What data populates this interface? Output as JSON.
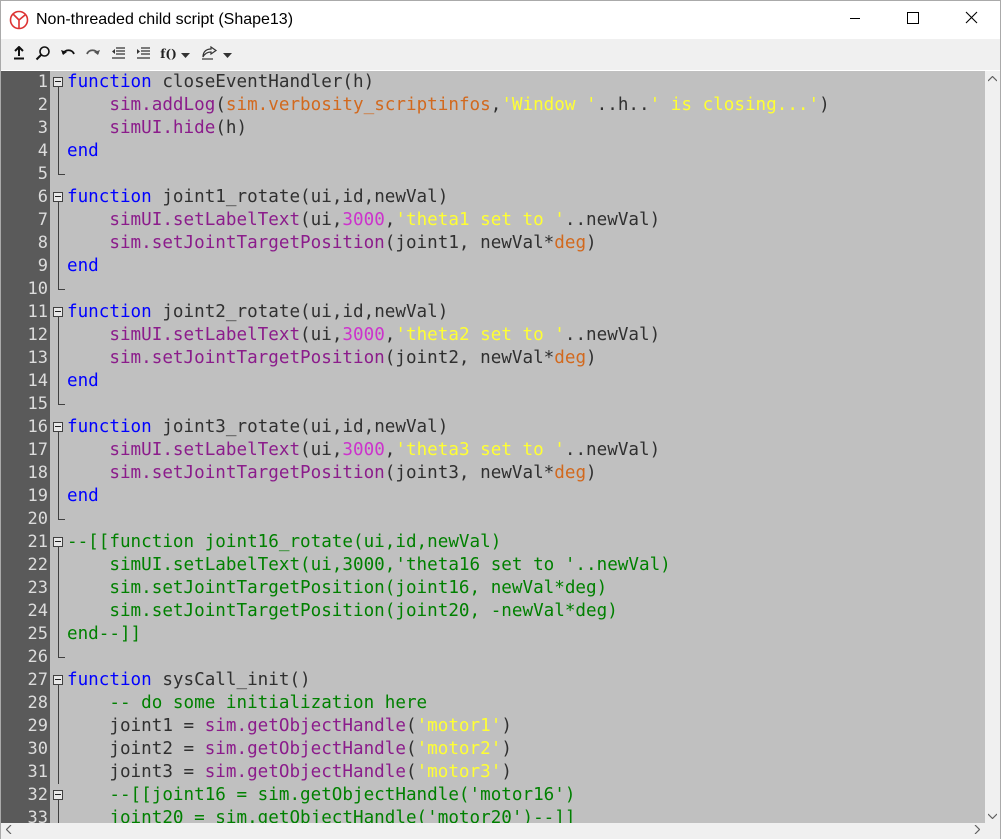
{
  "window": {
    "title": "Non-threaded child script (Shape13)",
    "buttons": {
      "minimize": "minimize-icon",
      "maximize": "maximize-icon",
      "close": "close-icon"
    }
  },
  "toolbar": {
    "items": [
      {
        "name": "export-icon"
      },
      {
        "name": "search-icon"
      },
      {
        "name": "undo-icon"
      },
      {
        "name": "redo-icon"
      },
      {
        "name": "outdent-icon"
      },
      {
        "name": "indent-icon"
      },
      {
        "name": "function-list-icon",
        "label": "f()"
      },
      {
        "name": "script-settings-icon"
      }
    ]
  },
  "colors": {
    "background": "#c0c0c0",
    "gutter": "#5a5a5a",
    "keyword": "#0000ff",
    "sim_api": "#8b1c8b",
    "string": "#ffff33",
    "number": "#cc33cc",
    "comment": "#008000"
  },
  "editor": {
    "lines": [
      {
        "n": "1",
        "fold": "start",
        "tokens": [
          [
            "kw",
            "function"
          ],
          [
            "txt",
            " closeEventHandler(h)"
          ]
        ]
      },
      {
        "n": "2",
        "fold": "mid",
        "tokens": [
          [
            "txt",
            "    "
          ],
          [
            "sim",
            "sim.addLog"
          ],
          [
            "txt",
            "("
          ],
          [
            "deg",
            "sim.verbosity_scriptinfos"
          ],
          [
            "txt",
            ","
          ],
          [
            "str",
            "'Window '"
          ],
          [
            "txt",
            "..h.."
          ],
          [
            "str",
            "' is closing...'"
          ],
          [
            "txt",
            ")"
          ]
        ]
      },
      {
        "n": "3",
        "fold": "mid",
        "tokens": [
          [
            "txt",
            "    "
          ],
          [
            "sim",
            "simUI.hide"
          ],
          [
            "txt",
            "(h)"
          ]
        ]
      },
      {
        "n": "4",
        "fold": "mid",
        "tokens": [
          [
            "kw",
            "end"
          ]
        ]
      },
      {
        "n": "5",
        "fold": "end",
        "tokens": []
      },
      {
        "n": "6",
        "fold": "start",
        "tokens": [
          [
            "kw",
            "function"
          ],
          [
            "txt",
            " joint1_rotate(ui,id,newVal)"
          ]
        ]
      },
      {
        "n": "7",
        "fold": "mid",
        "tokens": [
          [
            "txt",
            "    "
          ],
          [
            "sim",
            "simUI.setLabelText"
          ],
          [
            "txt",
            "(ui,"
          ],
          [
            "num",
            "3000"
          ],
          [
            "txt",
            ","
          ],
          [
            "str",
            "'theta1 set to '"
          ],
          [
            "txt",
            "..newVal)"
          ]
        ]
      },
      {
        "n": "8",
        "fold": "mid",
        "tokens": [
          [
            "txt",
            "    "
          ],
          [
            "sim",
            "sim.setJointTargetPosition"
          ],
          [
            "txt",
            "(joint1, newVal*"
          ],
          [
            "deg",
            "deg"
          ],
          [
            "txt",
            ")"
          ]
        ]
      },
      {
        "n": "9",
        "fold": "mid",
        "tokens": [
          [
            "kw",
            "end"
          ]
        ]
      },
      {
        "n": "10",
        "fold": "end",
        "tokens": []
      },
      {
        "n": "11",
        "fold": "start",
        "tokens": [
          [
            "kw",
            "function"
          ],
          [
            "txt",
            " joint2_rotate(ui,id,newVal)"
          ]
        ]
      },
      {
        "n": "12",
        "fold": "mid",
        "tokens": [
          [
            "txt",
            "    "
          ],
          [
            "sim",
            "simUI.setLabelText"
          ],
          [
            "txt",
            "(ui,"
          ],
          [
            "num",
            "3000"
          ],
          [
            "txt",
            ","
          ],
          [
            "str",
            "'theta2 set to '"
          ],
          [
            "txt",
            "..newVal)"
          ]
        ]
      },
      {
        "n": "13",
        "fold": "mid",
        "tokens": [
          [
            "txt",
            "    "
          ],
          [
            "sim",
            "sim.setJointTargetPosition"
          ],
          [
            "txt",
            "(joint2, newVal*"
          ],
          [
            "deg",
            "deg"
          ],
          [
            "txt",
            ")"
          ]
        ]
      },
      {
        "n": "14",
        "fold": "mid",
        "tokens": [
          [
            "kw",
            "end"
          ]
        ]
      },
      {
        "n": "15",
        "fold": "end",
        "tokens": []
      },
      {
        "n": "16",
        "fold": "start",
        "tokens": [
          [
            "kw",
            "function"
          ],
          [
            "txt",
            " joint3_rotate(ui,id,newVal)"
          ]
        ]
      },
      {
        "n": "17",
        "fold": "mid",
        "tokens": [
          [
            "txt",
            "    "
          ],
          [
            "sim",
            "simUI.setLabelText"
          ],
          [
            "txt",
            "(ui,"
          ],
          [
            "num",
            "3000"
          ],
          [
            "txt",
            ","
          ],
          [
            "str",
            "'theta3 set to '"
          ],
          [
            "txt",
            "..newVal)"
          ]
        ]
      },
      {
        "n": "18",
        "fold": "mid",
        "tokens": [
          [
            "txt",
            "    "
          ],
          [
            "sim",
            "sim.setJointTargetPosition"
          ],
          [
            "txt",
            "(joint3, newVal*"
          ],
          [
            "deg",
            "deg"
          ],
          [
            "txt",
            ")"
          ]
        ]
      },
      {
        "n": "19",
        "fold": "mid",
        "tokens": [
          [
            "kw",
            "end"
          ]
        ]
      },
      {
        "n": "20",
        "fold": "end",
        "tokens": []
      },
      {
        "n": "21",
        "fold": "start",
        "tokens": [
          [
            "cmt",
            "--[[function joint16_rotate(ui,id,newVal)"
          ]
        ]
      },
      {
        "n": "22",
        "fold": "mid",
        "tokens": [
          [
            "cmt",
            "    simUI.setLabelText(ui,3000,'theta16 set to '..newVal)"
          ]
        ]
      },
      {
        "n": "23",
        "fold": "mid",
        "tokens": [
          [
            "cmt",
            "    sim.setJointTargetPosition(joint16, newVal*deg)"
          ]
        ]
      },
      {
        "n": "24",
        "fold": "mid",
        "tokens": [
          [
            "cmt",
            "    sim.setJointTargetPosition(joint20, -newVal*deg)"
          ]
        ]
      },
      {
        "n": "25",
        "fold": "mid",
        "tokens": [
          [
            "cmt",
            "end--]]"
          ]
        ]
      },
      {
        "n": "26",
        "fold": "end",
        "tokens": []
      },
      {
        "n": "27",
        "fold": "start",
        "tokens": [
          [
            "kw",
            "function"
          ],
          [
            "txt",
            " sysCall_init()"
          ]
        ]
      },
      {
        "n": "28",
        "fold": "mid",
        "tokens": [
          [
            "cmt",
            "    -- do some initialization here"
          ]
        ]
      },
      {
        "n": "29",
        "fold": "mid",
        "tokens": [
          [
            "txt",
            "    joint1 = "
          ],
          [
            "sim",
            "sim.getObjectHandle"
          ],
          [
            "txt",
            "("
          ],
          [
            "str",
            "'motor1'"
          ],
          [
            "txt",
            ")"
          ]
        ]
      },
      {
        "n": "30",
        "fold": "mid",
        "tokens": [
          [
            "txt",
            "    joint2 = "
          ],
          [
            "sim",
            "sim.getObjectHandle"
          ],
          [
            "txt",
            "("
          ],
          [
            "str",
            "'motor2'"
          ],
          [
            "txt",
            ")"
          ]
        ]
      },
      {
        "n": "31",
        "fold": "mid",
        "tokens": [
          [
            "txt",
            "    joint3 = "
          ],
          [
            "sim",
            "sim.getObjectHandle"
          ],
          [
            "txt",
            "("
          ],
          [
            "str",
            "'motor3'"
          ],
          [
            "txt",
            ")"
          ]
        ]
      },
      {
        "n": "32",
        "fold": "start",
        "tokens": [
          [
            "cmt",
            "    --[[joint16 = sim.getObjectHandle('motor16')"
          ]
        ]
      },
      {
        "n": "33",
        "fold": "mid",
        "tokens": [
          [
            "cmt",
            "    joint20 = sim.getObjectHandle('motor20')--]]"
          ]
        ]
      }
    ]
  }
}
